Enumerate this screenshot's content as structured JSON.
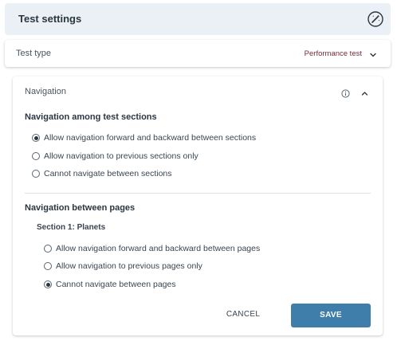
{
  "header": {
    "title": "Test settings",
    "icon": "magic-wand-icon"
  },
  "test_type": {
    "label": "Test type",
    "value": "Performance test"
  },
  "navigation": {
    "title": "Navigation",
    "sections": {
      "heading": "Navigation among test sections",
      "options": [
        {
          "label": "Allow navigation forward and backward between sections",
          "checked": true
        },
        {
          "label": "Allow navigation to previous sections only",
          "checked": false
        },
        {
          "label": "Cannot navigate between sections",
          "checked": false
        }
      ]
    },
    "pages": {
      "heading": "Navigation between pages",
      "subsection": "Section 1: Planets",
      "options": [
        {
          "label": "Allow navigation forward and backward between pages",
          "checked": false
        },
        {
          "label": "Allow navigation to previous pages only",
          "checked": false
        },
        {
          "label": "Cannot navigate between pages",
          "checked": true
        }
      ]
    }
  },
  "actions": {
    "cancel_label": "CANCEL",
    "save_label": "SAVE"
  },
  "colors": {
    "header_bg": "#eaf0f6",
    "accent": "#3f7eab",
    "test_type_value": "#7a2a3a"
  }
}
